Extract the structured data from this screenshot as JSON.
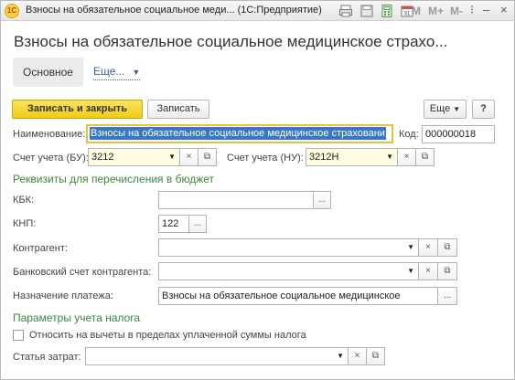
{
  "window": {
    "title": "Взносы на обязательное социальное меди...   (1С:Предприятие)",
    "toolbar_letters": [
      "M",
      "M+",
      "M-"
    ]
  },
  "form": {
    "title": "Взносы на обязательное социальное медицинское страхо...",
    "tabs": {
      "main": "Основное",
      "more": "Еще..."
    }
  },
  "buttons": {
    "save_close": "Записать и закрыть",
    "save": "Записать",
    "more": "Еще",
    "help": "?"
  },
  "fields": {
    "name_label": "Наименование:",
    "name_value": "Взносы на обязательное социальное медицинское страховани",
    "code_label": "Код:",
    "code_value": "000000018",
    "account_bu_label": "Счет учета (БУ):",
    "account_bu_value": "3212",
    "account_nu_label": "Счет учета (НУ):",
    "account_nu_value": "3212Н"
  },
  "budget_section": {
    "title": "Реквизиты для перечисления в бюджет",
    "kbk_label": "КБК:",
    "kbk_value": "",
    "knp_label": "КНП:",
    "knp_value": "122",
    "contractor_label": "Контрагент:",
    "contractor_value": "",
    "bank_account_label": "Банковский счет контрагента:",
    "bank_account_value": "",
    "purpose_label": "Назначение платежа:",
    "purpose_value": "Взносы на обязательное социальное медицинское"
  },
  "tax_section": {
    "title": "Параметры учета налога",
    "deduction_checkbox_label": "Относить на вычеты в пределах уплаченной суммы налога",
    "deduction_checked": false,
    "expense_item_label": "Статья затрат:",
    "expense_item_value": ""
  },
  "glyphs": {
    "dropdown": "▼",
    "clear": "×",
    "ellipsis": "...",
    "open": "⧉"
  },
  "colors": {
    "primary_button": "#f0cb1a",
    "section_heading": "#3b8a3b",
    "link": "#3a5fa8",
    "selection": "#3876c9",
    "active_border": "#e8c23a"
  }
}
